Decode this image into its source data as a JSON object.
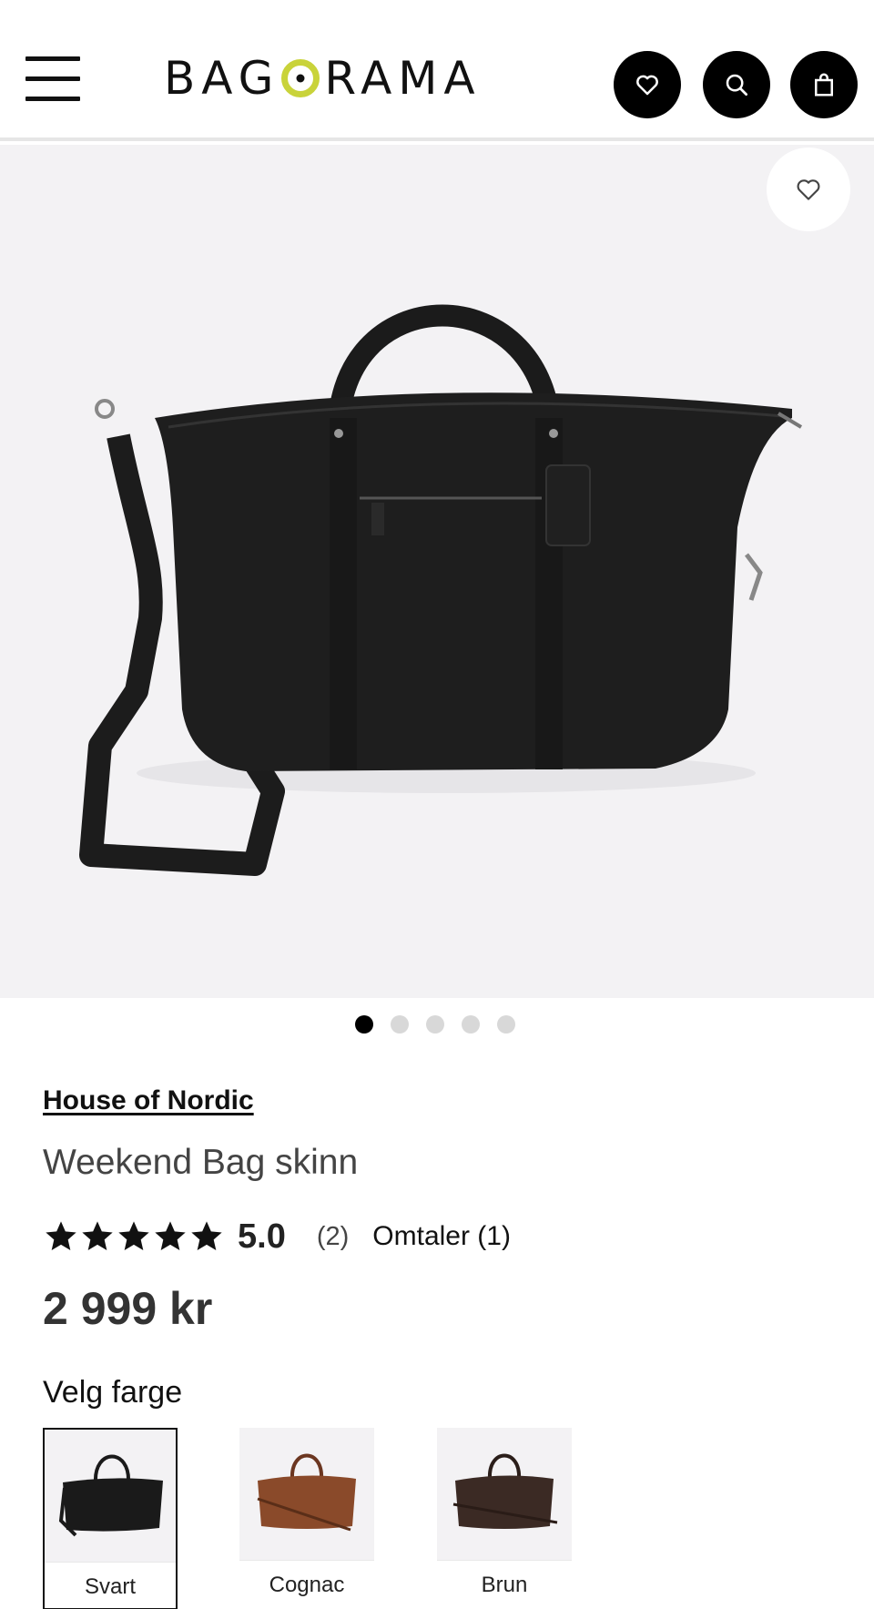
{
  "header": {
    "logo_text_left": "BAG",
    "logo_text_right": "RAMA",
    "icons": [
      "menu-icon",
      "heart-icon",
      "search-icon",
      "bag-icon"
    ]
  },
  "gallery": {
    "slide_count": 5,
    "active_slide": 1
  },
  "product": {
    "brand": "House of Nordic",
    "title": "Weekend Bag skinn",
    "rating": {
      "stars": 5,
      "value": "5.0",
      "count": "(2)",
      "reviews_link": "Omtaler (1)"
    },
    "price": "2 999 kr"
  },
  "colors": {
    "label": "Velg farge",
    "options": [
      {
        "name": "Svart",
        "hex": "#1a1a1a",
        "selected": true
      },
      {
        "name": "Cognac",
        "hex": "#8a4a2a",
        "selected": false
      },
      {
        "name": "Brun",
        "hex": "#3b2a24",
        "selected": false
      }
    ]
  }
}
